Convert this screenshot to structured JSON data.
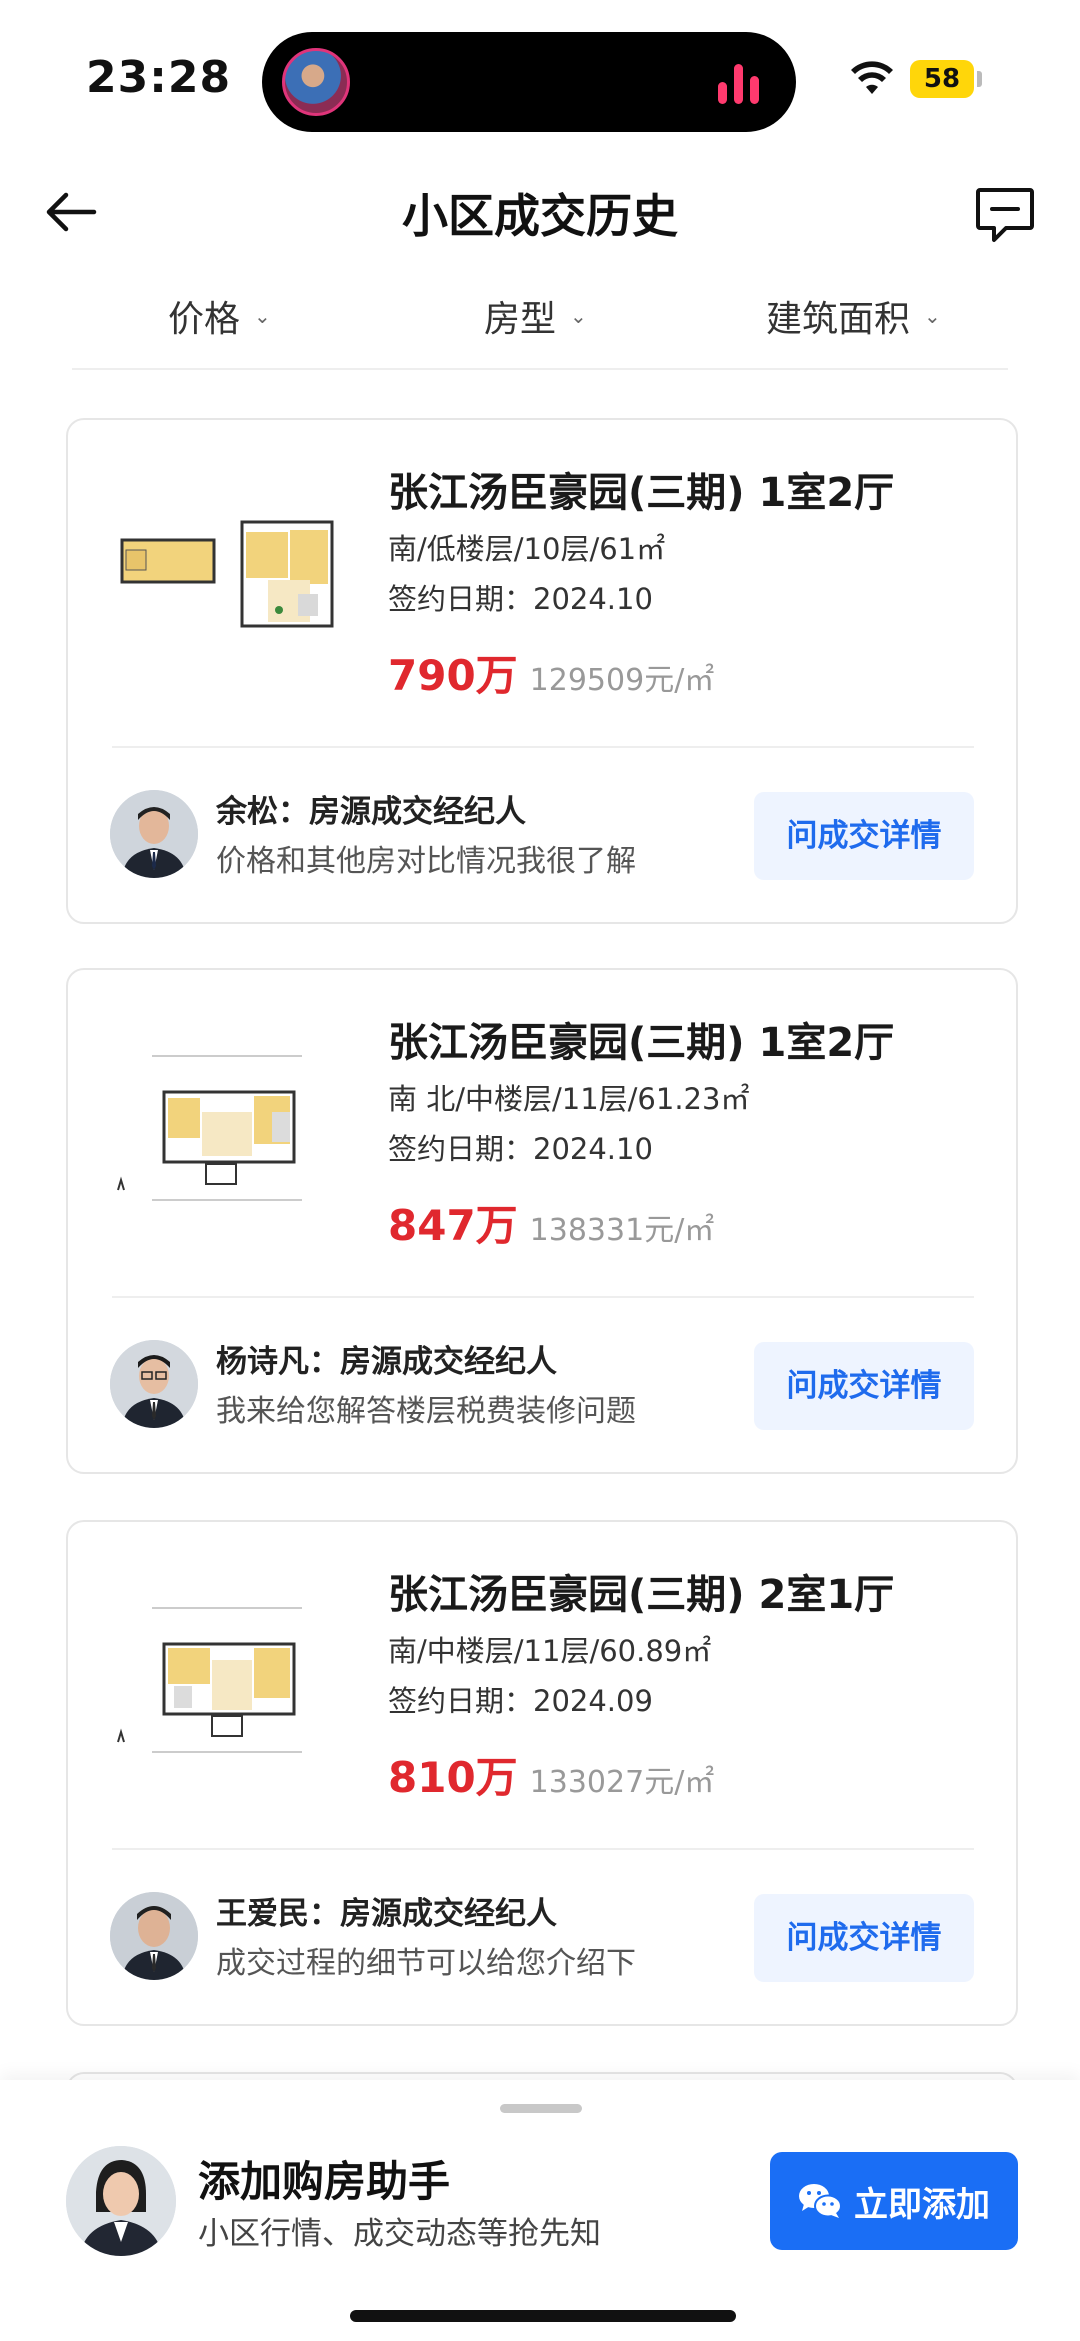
{
  "status_bar": {
    "time": "23:28",
    "battery": "58"
  },
  "header": {
    "title": "小区成交历史"
  },
  "filters": [
    {
      "label": "价格"
    },
    {
      "label": "房型"
    },
    {
      "label": "建筑面积"
    }
  ],
  "listings": [
    {
      "title": "张江汤臣豪园(三期) 1室2厅",
      "spec": "南/低楼层/10层/61㎡",
      "date": "签约日期：2024.10",
      "price": "790万",
      "unit_price": "129509元/㎡",
      "agent_name": "余松：房源成交经纪人",
      "agent_desc": "价格和其他房对比情况我很了解",
      "button": "问成交详情"
    },
    {
      "title": "张江汤臣豪园(三期) 1室2厅",
      "spec": "南 北/中楼层/11层/61.23㎡",
      "date": "签约日期：2024.10",
      "price": "847万",
      "unit_price": "138331元/㎡",
      "agent_name": "杨诗凡：房源成交经纪人",
      "agent_desc": "我来给您解答楼层税费装修问题",
      "button": "问成交详情"
    },
    {
      "title": "张江汤臣豪园(三期) 2室1厅",
      "spec": "南/中楼层/11层/60.89㎡",
      "date": "签约日期：2024.09",
      "price": "810万",
      "unit_price": "133027元/㎡",
      "agent_name": "王爱民：房源成交经纪人",
      "agent_desc": "成交过程的细节可以给您介绍下",
      "button": "问成交详情"
    }
  ],
  "assistant": {
    "title": "添加购房助手",
    "subtitle": "小区行情、成交动态等抢先知",
    "button": "立即添加"
  },
  "icons": {
    "back": "arrow-left-icon",
    "message": "message-square-icon",
    "wechat": "wechat-icon"
  },
  "colors": {
    "price": "#e0282e",
    "accent": "#1a6ef5"
  }
}
